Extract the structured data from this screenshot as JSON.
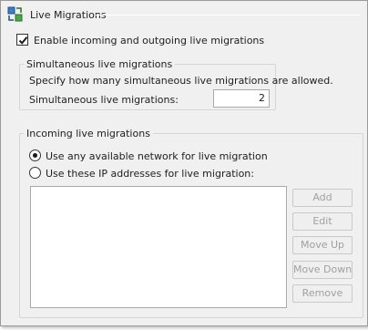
{
  "header": {
    "title": "Live Migrations",
    "icon": "live-migration-icon"
  },
  "enable": {
    "label": "Enable incoming and outgoing live migrations",
    "checked": true
  },
  "simultaneous": {
    "group_title": "Simultaneous live migrations",
    "description": "Specify how many simultaneous live migrations are allowed.",
    "field_label": "Simultaneous live migrations:",
    "value": "2"
  },
  "incoming": {
    "group_title": "Incoming live migrations",
    "options": [
      {
        "label": "Use any available network for live migration",
        "selected": true
      },
      {
        "label": "Use these IP addresses for live migration:",
        "selected": false
      }
    ],
    "ip_list": []
  },
  "buttons": {
    "add": "Add",
    "edit": "Edit",
    "move_up": "Move Up",
    "move_down": "Move Down",
    "remove": "Remove"
  },
  "colors": {
    "panel_bg": "#f0f0f0",
    "disabled_text": "#a0a0a0"
  }
}
